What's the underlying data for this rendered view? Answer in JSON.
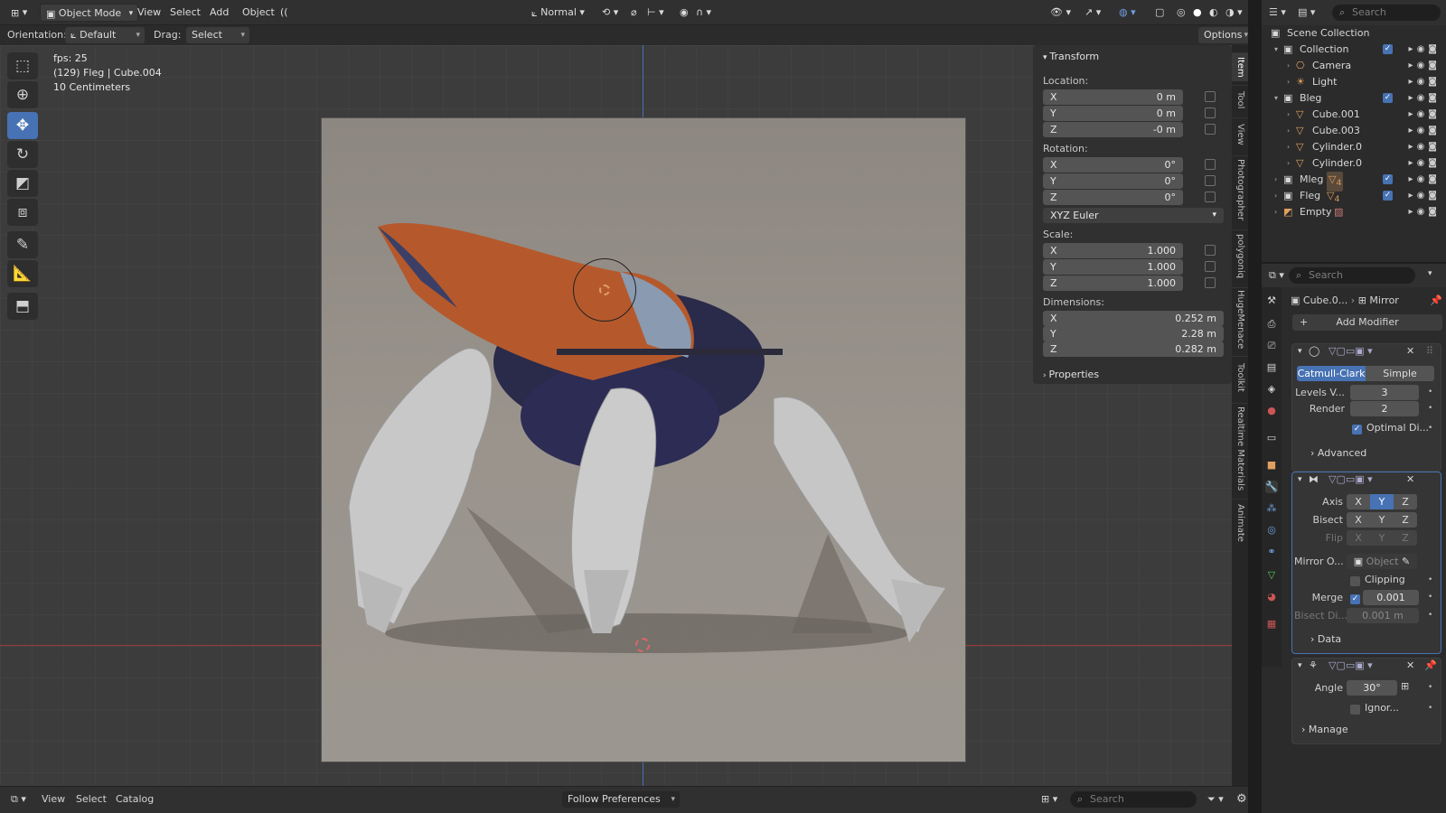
{
  "header": {
    "mode": "Object Mode",
    "menus": [
      "View",
      "Select",
      "Add",
      "Object"
    ],
    "transform_orientation": "Normal",
    "search_placeholder": "Search"
  },
  "tool_header": {
    "orientation_label": "Orientation:",
    "orientation_value": "Default",
    "drag_label": "Drag:",
    "drag_value": "Select Box",
    "options": "Options"
  },
  "overlay": {
    "fps": "fps: 25",
    "object_info": "(129) Fleg | Cube.004",
    "grid_scale": "10 Centimeters"
  },
  "transform_panel": {
    "title": "Transform",
    "location_label": "Location:",
    "location": [
      {
        "axis": "X",
        "value": "0 m"
      },
      {
        "axis": "Y",
        "value": "0 m"
      },
      {
        "axis": "Z",
        "value": "-0 m"
      }
    ],
    "rotation_label": "Rotation:",
    "rotation": [
      {
        "axis": "X",
        "value": "0°"
      },
      {
        "axis": "Y",
        "value": "0°"
      },
      {
        "axis": "Z",
        "value": "0°"
      }
    ],
    "rotation_mode": "XYZ Euler",
    "scale_label": "Scale:",
    "scale": [
      {
        "axis": "X",
        "value": "1.000"
      },
      {
        "axis": "Y",
        "value": "1.000"
      },
      {
        "axis": "Z",
        "value": "1.000"
      }
    ],
    "dimensions_label": "Dimensions:",
    "dimensions": [
      {
        "axis": "X",
        "value": "0.252 m"
      },
      {
        "axis": "Y",
        "value": "2.28 m"
      },
      {
        "axis": "Z",
        "value": "0.282 m"
      }
    ],
    "properties": "Properties"
  },
  "side_tabs": [
    "Item",
    "Tool",
    "View",
    "Photographer",
    "polygoniq",
    "HugeMenace",
    "Toolkit",
    "Realtime Materials",
    "Animate"
  ],
  "outliner": {
    "search_placeholder": "Search",
    "root": "Scene Collection",
    "items": [
      {
        "label": "Collection",
        "depth": 0
      },
      {
        "label": "Camera",
        "depth": 1
      },
      {
        "label": "Light",
        "depth": 1
      },
      {
        "label": "Bleg",
        "depth": 0
      },
      {
        "label": "Cube.001",
        "depth": 1
      },
      {
        "label": "Cube.003",
        "depth": 1
      },
      {
        "label": "Cylinder.0",
        "depth": 1
      },
      {
        "label": "Cylinder.0",
        "depth": 1
      },
      {
        "label": "Mleg",
        "depth": 0
      },
      {
        "label": "Fleg",
        "depth": 0
      },
      {
        "label": "Empty",
        "depth": 0
      }
    ],
    "badge_mleg": "4",
    "badge_fleg": "4"
  },
  "properties": {
    "search_placeholder": "Search",
    "breadcrumb_object": "Cube.0...",
    "breadcrumb_modifier": "Mirror",
    "add_modifier": "Add Modifier",
    "subsurf": {
      "type_a": "Catmull-Clark",
      "type_b": "Simple",
      "levels_label": "Levels V...",
      "levels_value": "3",
      "render_label": "Render",
      "render_value": "2",
      "optimal_label": "Optimal Di...",
      "advanced": "Advanced"
    },
    "mirror": {
      "axis_label": "Axis",
      "bisect_label": "Bisect",
      "flip_label": "Flip",
      "xyz": [
        "X",
        "Y",
        "Z"
      ],
      "mirror_object_label": "Mirror O...",
      "mirror_object_placeholder": "Object",
      "clipping_label": "Clipping",
      "merge_label": "Merge",
      "merge_value": "0.001",
      "bisect_dist_label": "Bisect Di...",
      "bisect_dist_value": "0.001 m",
      "data": "Data"
    },
    "smooth": {
      "angle_label": "Angle",
      "angle_value": "30°",
      "ignore_label": "Ignor...",
      "manage": "Manage"
    }
  },
  "bottom": {
    "menus": [
      "View",
      "Select",
      "Catalog"
    ],
    "follow": "Follow Preferences",
    "search_placeholder": "Search"
  },
  "colors": {
    "accent": "#4772b3",
    "panel": "#303030",
    "field": "#545454",
    "x_axis": "#b33a3a",
    "y_axis": "#4a6fb5"
  }
}
